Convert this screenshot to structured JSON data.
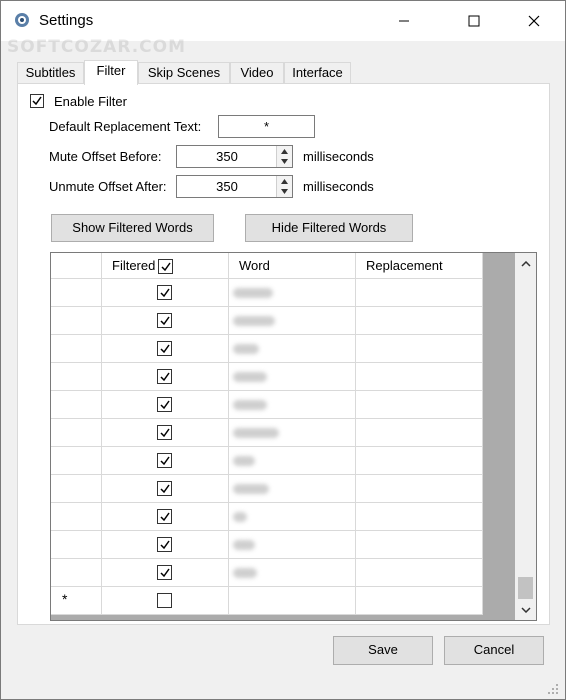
{
  "window": {
    "title": "Settings"
  },
  "watermark": "SOFTCOZAR.COM",
  "tabs": [
    {
      "label": "Subtitles"
    },
    {
      "label": "Filter"
    },
    {
      "label": "Skip Scenes"
    },
    {
      "label": "Video"
    },
    {
      "label": "Interface"
    }
  ],
  "filter": {
    "enable_label": "Enable Filter",
    "enabled": true,
    "default_replacement_label": "Default Replacement Text:",
    "default_replacement_value": "*",
    "mute_before_label": "Mute Offset Before:",
    "mute_before_value": "350",
    "unmute_after_label": "Unmute Offset After:",
    "unmute_after_value": "350",
    "ms_label": "milliseconds",
    "show_words_button": "Show Filtered Words",
    "hide_words_button": "Hide Filtered Words"
  },
  "grid": {
    "columns": {
      "filtered": "Filtered",
      "word": "Word",
      "replacement": "Replacement"
    },
    "new_row_marker": "*"
  },
  "footer": {
    "save_label": "Save",
    "cancel_label": "Cancel"
  }
}
